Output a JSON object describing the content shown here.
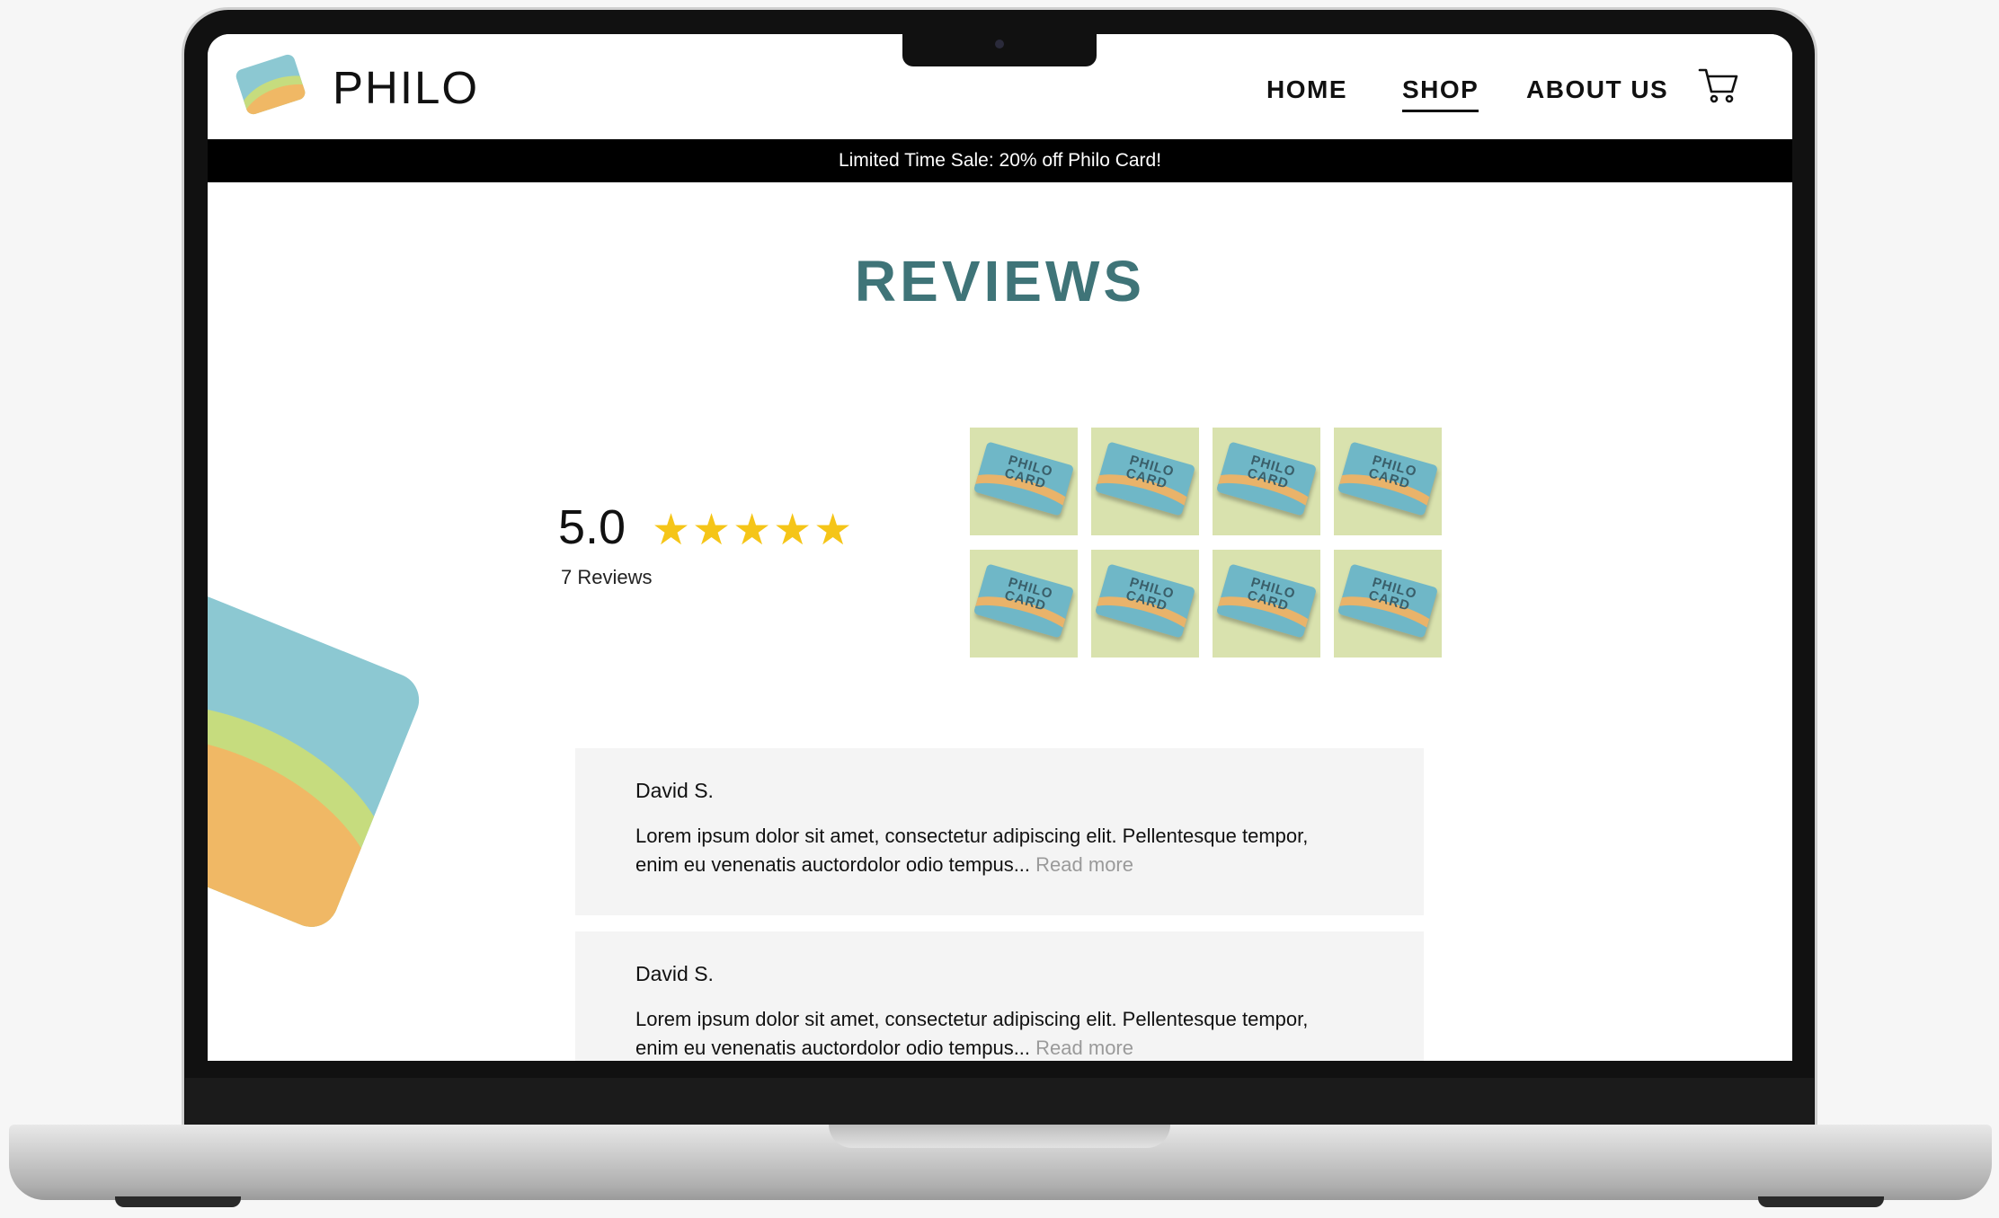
{
  "header": {
    "brand": "PHILO",
    "nav": [
      {
        "label": "HOME",
        "active": false
      },
      {
        "label": "SHOP",
        "active": true
      },
      {
        "label": "ABOUT US",
        "active": false
      }
    ],
    "cart_icon": "shopping-cart-icon"
  },
  "banner": {
    "text": "Limited Time Sale: 20% off Philo Card!"
  },
  "reviews_section": {
    "title": "REVIEWS",
    "rating": "5.0",
    "stars": "★★★★★",
    "star_count": 5,
    "count_label": "7 Reviews",
    "product_text": "PHILO CARD",
    "thumbnail_count": 8
  },
  "reviews": [
    {
      "name": "David S.",
      "text": "Lorem ipsum dolor sit amet, consectetur adipiscing elit. Pellentesque tempor, enim eu venenatis auctordolor odio tempus... ",
      "read_more": "Read more"
    },
    {
      "name": "David S.",
      "text": "Lorem ipsum dolor sit amet, consectetur adipiscing elit. Pellentesque tempor, enim eu venenatis auctordolor odio tempus... ",
      "read_more": "Read more"
    }
  ],
  "colors": {
    "accent": "#3f7478",
    "star": "#f5c518",
    "brand_blue": "#8cc8d2",
    "brand_green": "#c6dc7e",
    "brand_orange": "#f0b865"
  }
}
